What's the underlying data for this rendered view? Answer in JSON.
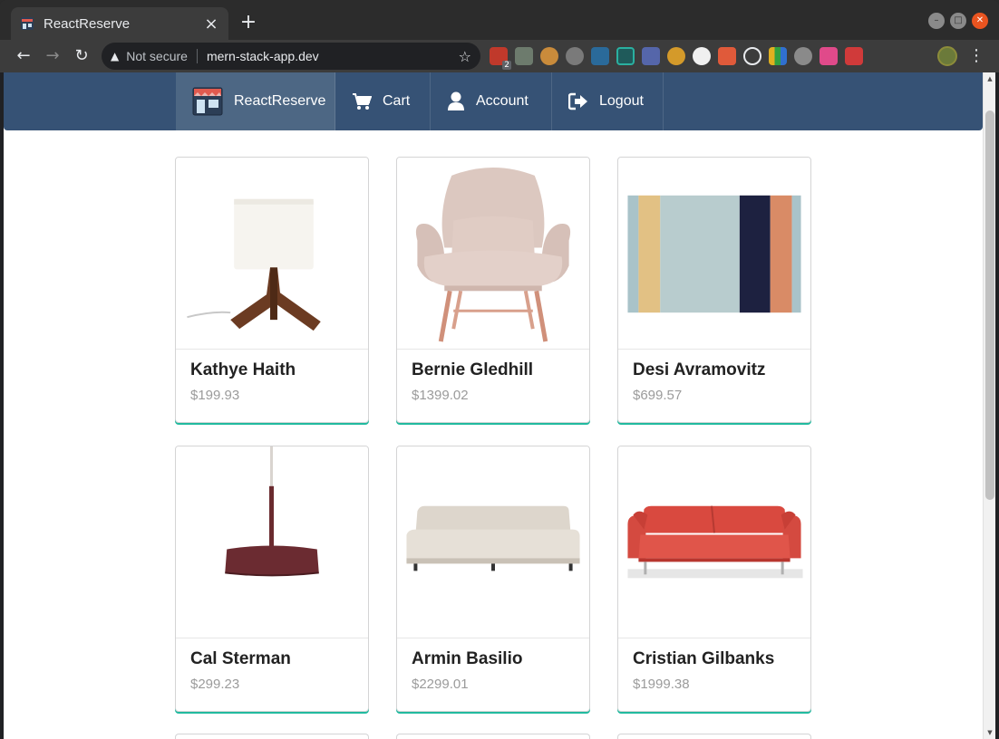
{
  "browser": {
    "tab_title": "ReactReserve",
    "tab_close": "×",
    "new_tab": "+",
    "security_label": "Not secure",
    "url": "mern-stack-app.dev",
    "adblock_badge": "2"
  },
  "site_nav": {
    "brand_label": "ReactReserve",
    "cart_label": "Cart",
    "account_label": "Account",
    "logout_label": "Logout",
    "bg_color": "#365275",
    "active_color": "#4d6784"
  },
  "products": [
    {
      "name": "Kathye Haith",
      "price": "$199.93",
      "image": "table-lamp"
    },
    {
      "name": "Bernie Gledhill",
      "price": "$1399.02",
      "image": "lounge-chair"
    },
    {
      "name": "Desi Avramovitz",
      "price": "$699.57",
      "image": "striped-rug"
    },
    {
      "name": "Cal Sterman",
      "price": "$299.23",
      "image": "pendant-lamp"
    },
    {
      "name": "Armin Basilio",
      "price": "$2299.01",
      "image": "beige-sofa"
    },
    {
      "name": "Cristian Gilbanks",
      "price": "$1999.38",
      "image": "red-sofa"
    }
  ],
  "colors": {
    "card_accent": "#21ba9f",
    "price_text": "#9b9b9b"
  }
}
